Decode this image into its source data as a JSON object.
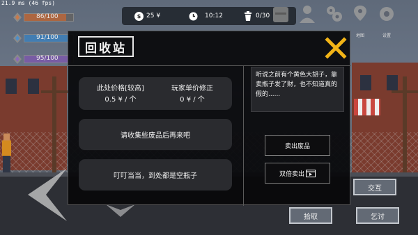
{
  "fps": "21.9 ms (46 fps)",
  "stats": [
    {
      "label": "86/100",
      "fill": 0.86,
      "color": "#b5663b",
      "icon": "heart-icon"
    },
    {
      "label": "91/100",
      "fill": 0.91,
      "color": "#3f7fb8",
      "icon": "water-drop-icon"
    },
    {
      "label": "95/100",
      "fill": 0.95,
      "color": "#7a5aa8",
      "icon": "gem-icon"
    }
  ],
  "hud": {
    "money": "25 ¥",
    "time": "10:12",
    "bag": "0/30"
  },
  "top_menu": {
    "map_label": "地图",
    "settings_label": "设置"
  },
  "dialog": {
    "title": "回收站",
    "price_label": "此处价格[较高]",
    "price_value": "0.5 ¥ / 个",
    "player_label": "玩家单价修正",
    "player_value": "0 ¥ / 个",
    "message1": "请收集些废品后再来吧",
    "message2": "叮叮当当，到处都是空瓶子",
    "story": "听说之前有个黄色大胡子，靠卖瓶子发了财，也不知道真的假的......",
    "sell_label": "卖出废品",
    "double_label": "双倍卖出"
  },
  "side_buttons": {
    "interact": "交互",
    "pickup": "拾取",
    "beg": "乞讨"
  },
  "colors": {
    "close_accent": "#f2b417",
    "dialog_bg": "#08080a",
    "panel_bg": "#2a2b2f"
  }
}
